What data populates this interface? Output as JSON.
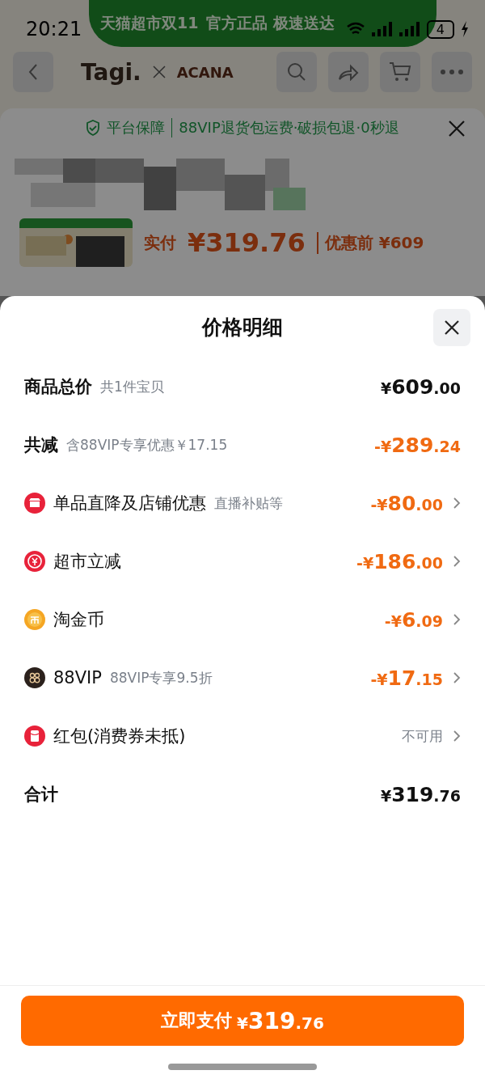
{
  "status_bar": {
    "time": "20:21",
    "battery": "4"
  },
  "banner": {
    "title": "天猫超市双11",
    "slogan": "官方正品 极速送达"
  },
  "header": {
    "brand": "Tagi.",
    "partner": "ACANA"
  },
  "product_sheet": {
    "guarantee_label": "平台保障",
    "guarantee_text": "88VIP退货包运费·破损包退·0秒退",
    "paid_label": "实付",
    "paid_amount": "¥319.76",
    "original_price": "优惠前 ¥609"
  },
  "price_detail": {
    "title": "价格明细",
    "rows": [
      {
        "kind": "total",
        "title": "商品总价",
        "note": "共1件宝贝",
        "amount": "¥609.00"
      },
      {
        "kind": "saving",
        "title": "共减",
        "note": "含88VIP专享优惠￥17.15",
        "amount": "-¥289.24"
      },
      {
        "kind": "discount",
        "title": "单品直降及店铺优惠",
        "note": "直播补贴等",
        "amount": "-¥80.00"
      },
      {
        "kind": "discount",
        "title": "超市立减",
        "amount": "-¥186.00"
      },
      {
        "kind": "discount",
        "title": "淘金币",
        "amount": "-¥6.09"
      },
      {
        "kind": "discount",
        "title": "88VIP",
        "note": "88VIP专享9.5折",
        "amount": "-¥17.15"
      },
      {
        "kind": "unavailable",
        "title": "红包(消费券未抵)",
        "status": "不可用"
      },
      {
        "kind": "total",
        "title": "合计",
        "amount": "¥319.76"
      }
    ]
  },
  "pay_button": {
    "label": "立即支付",
    "amount": "¥319.76"
  }
}
